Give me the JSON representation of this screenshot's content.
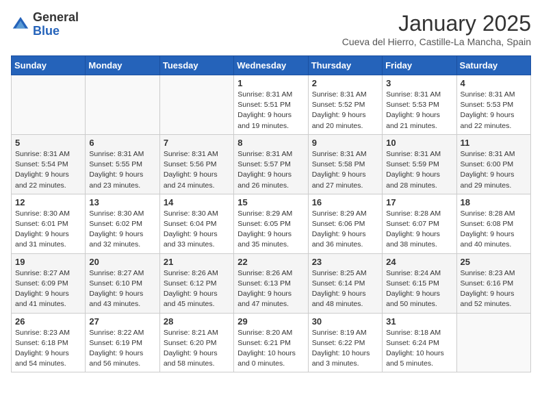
{
  "logo": {
    "general": "General",
    "blue": "Blue"
  },
  "header": {
    "month": "January 2025",
    "location": "Cueva del Hierro, Castille-La Mancha, Spain"
  },
  "days_of_week": [
    "Sunday",
    "Monday",
    "Tuesday",
    "Wednesday",
    "Thursday",
    "Friday",
    "Saturday"
  ],
  "weeks": [
    [
      {
        "day": "",
        "info": ""
      },
      {
        "day": "",
        "info": ""
      },
      {
        "day": "",
        "info": ""
      },
      {
        "day": "1",
        "info": "Sunrise: 8:31 AM\nSunset: 5:51 PM\nDaylight: 9 hours\nand 19 minutes."
      },
      {
        "day": "2",
        "info": "Sunrise: 8:31 AM\nSunset: 5:52 PM\nDaylight: 9 hours\nand 20 minutes."
      },
      {
        "day": "3",
        "info": "Sunrise: 8:31 AM\nSunset: 5:53 PM\nDaylight: 9 hours\nand 21 minutes."
      },
      {
        "day": "4",
        "info": "Sunrise: 8:31 AM\nSunset: 5:53 PM\nDaylight: 9 hours\nand 22 minutes."
      }
    ],
    [
      {
        "day": "5",
        "info": "Sunrise: 8:31 AM\nSunset: 5:54 PM\nDaylight: 9 hours\nand 22 minutes."
      },
      {
        "day": "6",
        "info": "Sunrise: 8:31 AM\nSunset: 5:55 PM\nDaylight: 9 hours\nand 23 minutes."
      },
      {
        "day": "7",
        "info": "Sunrise: 8:31 AM\nSunset: 5:56 PM\nDaylight: 9 hours\nand 24 minutes."
      },
      {
        "day": "8",
        "info": "Sunrise: 8:31 AM\nSunset: 5:57 PM\nDaylight: 9 hours\nand 26 minutes."
      },
      {
        "day": "9",
        "info": "Sunrise: 8:31 AM\nSunset: 5:58 PM\nDaylight: 9 hours\nand 27 minutes."
      },
      {
        "day": "10",
        "info": "Sunrise: 8:31 AM\nSunset: 5:59 PM\nDaylight: 9 hours\nand 28 minutes."
      },
      {
        "day": "11",
        "info": "Sunrise: 8:31 AM\nSunset: 6:00 PM\nDaylight: 9 hours\nand 29 minutes."
      }
    ],
    [
      {
        "day": "12",
        "info": "Sunrise: 8:30 AM\nSunset: 6:01 PM\nDaylight: 9 hours\nand 31 minutes."
      },
      {
        "day": "13",
        "info": "Sunrise: 8:30 AM\nSunset: 6:02 PM\nDaylight: 9 hours\nand 32 minutes."
      },
      {
        "day": "14",
        "info": "Sunrise: 8:30 AM\nSunset: 6:04 PM\nDaylight: 9 hours\nand 33 minutes."
      },
      {
        "day": "15",
        "info": "Sunrise: 8:29 AM\nSunset: 6:05 PM\nDaylight: 9 hours\nand 35 minutes."
      },
      {
        "day": "16",
        "info": "Sunrise: 8:29 AM\nSunset: 6:06 PM\nDaylight: 9 hours\nand 36 minutes."
      },
      {
        "day": "17",
        "info": "Sunrise: 8:28 AM\nSunset: 6:07 PM\nDaylight: 9 hours\nand 38 minutes."
      },
      {
        "day": "18",
        "info": "Sunrise: 8:28 AM\nSunset: 6:08 PM\nDaylight: 9 hours\nand 40 minutes."
      }
    ],
    [
      {
        "day": "19",
        "info": "Sunrise: 8:27 AM\nSunset: 6:09 PM\nDaylight: 9 hours\nand 41 minutes."
      },
      {
        "day": "20",
        "info": "Sunrise: 8:27 AM\nSunset: 6:10 PM\nDaylight: 9 hours\nand 43 minutes."
      },
      {
        "day": "21",
        "info": "Sunrise: 8:26 AM\nSunset: 6:12 PM\nDaylight: 9 hours\nand 45 minutes."
      },
      {
        "day": "22",
        "info": "Sunrise: 8:26 AM\nSunset: 6:13 PM\nDaylight: 9 hours\nand 47 minutes."
      },
      {
        "day": "23",
        "info": "Sunrise: 8:25 AM\nSunset: 6:14 PM\nDaylight: 9 hours\nand 48 minutes."
      },
      {
        "day": "24",
        "info": "Sunrise: 8:24 AM\nSunset: 6:15 PM\nDaylight: 9 hours\nand 50 minutes."
      },
      {
        "day": "25",
        "info": "Sunrise: 8:23 AM\nSunset: 6:16 PM\nDaylight: 9 hours\nand 52 minutes."
      }
    ],
    [
      {
        "day": "26",
        "info": "Sunrise: 8:23 AM\nSunset: 6:18 PM\nDaylight: 9 hours\nand 54 minutes."
      },
      {
        "day": "27",
        "info": "Sunrise: 8:22 AM\nSunset: 6:19 PM\nDaylight: 9 hours\nand 56 minutes."
      },
      {
        "day": "28",
        "info": "Sunrise: 8:21 AM\nSunset: 6:20 PM\nDaylight: 9 hours\nand 58 minutes."
      },
      {
        "day": "29",
        "info": "Sunrise: 8:20 AM\nSunset: 6:21 PM\nDaylight: 10 hours\nand 0 minutes."
      },
      {
        "day": "30",
        "info": "Sunrise: 8:19 AM\nSunset: 6:22 PM\nDaylight: 10 hours\nand 3 minutes."
      },
      {
        "day": "31",
        "info": "Sunrise: 8:18 AM\nSunset: 6:24 PM\nDaylight: 10 hours\nand 5 minutes."
      },
      {
        "day": "",
        "info": ""
      }
    ]
  ]
}
